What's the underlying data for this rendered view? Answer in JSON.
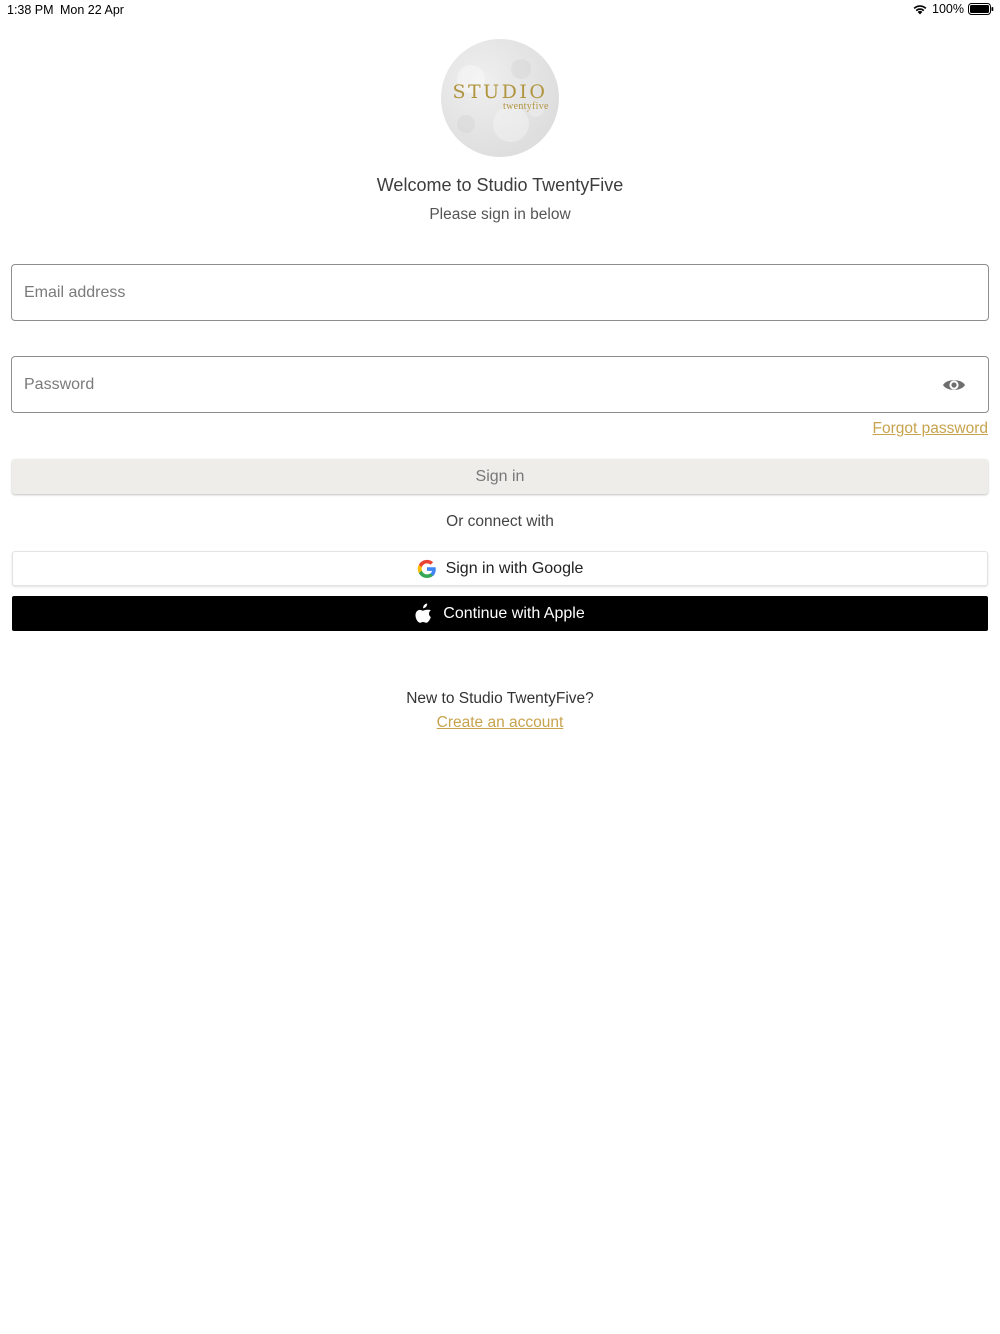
{
  "status_bar": {
    "time": "1:38 PM",
    "date": "Mon 22 Apr",
    "battery_percent": "100%",
    "icons": [
      "wifi-icon",
      "battery-icon"
    ]
  },
  "logo": {
    "word": "STUDIO",
    "sub": "twentyfive"
  },
  "header": {
    "welcome": "Welcome to Studio TwentyFive",
    "subtitle": "Please sign in below"
  },
  "form": {
    "email_placeholder": "Email address",
    "password_placeholder": "Password",
    "forgot_password": "Forgot password",
    "sign_in_label": "Sign in"
  },
  "social": {
    "or_connect": "Or connect with",
    "google_label": "Sign in with Google",
    "apple_label": "Continue with Apple"
  },
  "footer": {
    "new_to": "New to Studio TwentyFive?",
    "create_account": "Create an account"
  },
  "colors": {
    "accent_gold": "#c7a34d",
    "apple_button_bg": "#000000",
    "sign_in_button_bg": "#eeedea"
  }
}
